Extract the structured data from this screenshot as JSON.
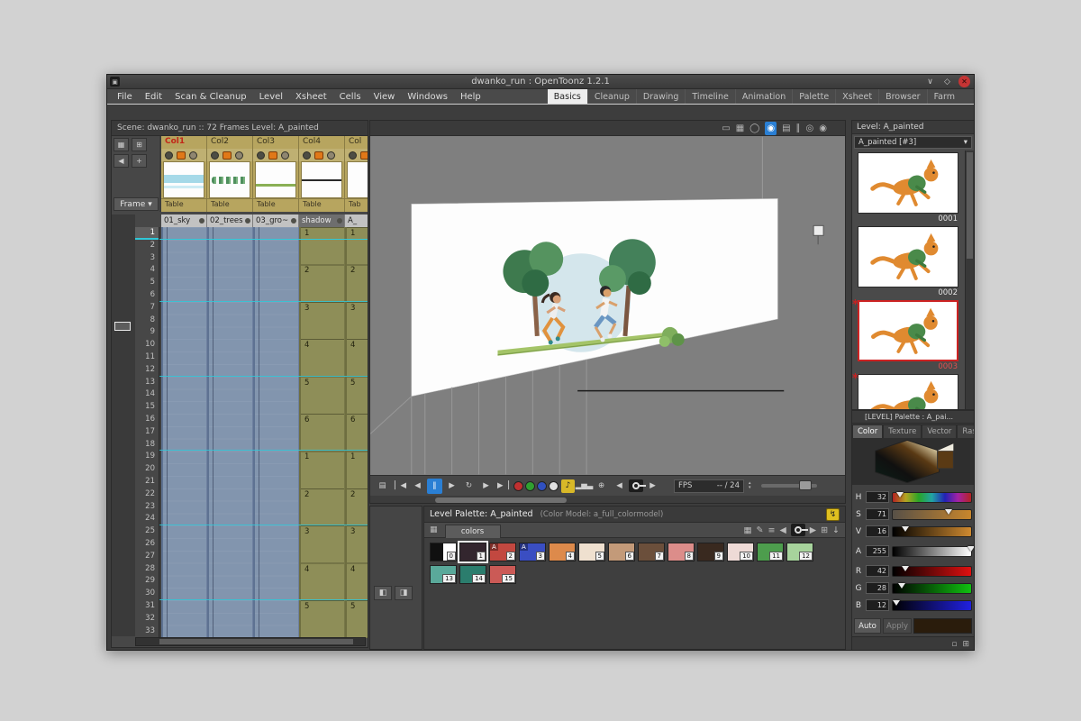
{
  "theme": {
    "bg-desktop": "#d2d2d2",
    "bg-window": "#484848",
    "accent-blue": "#2a7fd4",
    "cell-blue": "#8295ae",
    "cell-blue-line": "#5e7292",
    "cell-olive": "#8e8e58",
    "cell-olive-line": "#6e6e40",
    "header-tan": "#b7a55f",
    "current-cyan": "#30c8d8",
    "select-red": "#cc2222"
  },
  "window": {
    "title": "dwanko_run : OpenToonz 1.2.1",
    "app_icon_glyph": "▣",
    "controls": [
      {
        "name": "minimize-button",
        "glyph": "∨"
      },
      {
        "name": "restore-button",
        "glyph": "◇"
      },
      {
        "name": "close-button",
        "glyph": "✕",
        "close": true
      }
    ]
  },
  "menu": {
    "items": [
      "File",
      "Edit",
      "Scan & Cleanup",
      "Level",
      "Xsheet",
      "Cells",
      "View",
      "Windows",
      "Help"
    ]
  },
  "rooms": {
    "active_index": 0,
    "items": [
      "Basics",
      "Cleanup",
      "Drawing",
      "Timeline",
      "Animation",
      "Palette",
      "Xsheet",
      "Browser",
      "Farm"
    ]
  },
  "xsheet": {
    "scene_info": "Scene: dwanko_run    ::    72 Frames    Level: A_painted",
    "toolbar_top": [
      {
        "name": "xsheet-table-icon",
        "glyph": "▦"
      },
      {
        "name": "xsheet-add-level-icon",
        "glyph": "⊞"
      }
    ],
    "toolbar_second": [
      {
        "name": "collapse-columns-icon",
        "glyph": "◀"
      },
      {
        "name": "new-level-icon",
        "glyph": "+"
      }
    ],
    "frame_button": "Frame",
    "frame_button_arrow": "▾",
    "columns": [
      {
        "header": "Col1",
        "header_red": true,
        "name": "01_sky",
        "table": "Table",
        "thumb": "sky"
      },
      {
        "header": "Col2",
        "name": "02_trees",
        "table": "Table",
        "thumb": "trees"
      },
      {
        "header": "Col3",
        "name": "03_gro~",
        "table": "Table",
        "thumb": "ground"
      },
      {
        "header": "Col4",
        "name": "shadow",
        "table": "Table",
        "thumb": "shadow",
        "dark_name": true
      },
      {
        "header": "Col",
        "name": "A_",
        "table": "Tab",
        "thumb": "none"
      }
    ],
    "frames": [
      1,
      2,
      3,
      4,
      5,
      6,
      7,
      8,
      9,
      10,
      11,
      12,
      13,
      14,
      15,
      16,
      17,
      18,
      19,
      20,
      21,
      22,
      23,
      24,
      25,
      26,
      27,
      28,
      29,
      30,
      31,
      32,
      33
    ],
    "cell_columns": [
      {
        "x": 0,
        "kind": "held"
      },
      {
        "x": 1,
        "kind": "held"
      },
      {
        "x": 2,
        "kind": "held"
      },
      {
        "x": 3,
        "kind": "keyed",
        "labels": [
          {
            "row": 1,
            "text": "1"
          },
          {
            "row": 4,
            "text": "2"
          },
          {
            "row": 7,
            "text": "3"
          },
          {
            "row": 10,
            "text": "4"
          },
          {
            "row": 13,
            "text": "5"
          },
          {
            "row": 16,
            "text": "6"
          },
          {
            "row": 19,
            "text": "1"
          },
          {
            "row": 22,
            "text": "2"
          },
          {
            "row": 25,
            "text": "3"
          },
          {
            "row": 28,
            "text": "4"
          },
          {
            "row": 31,
            "text": "5"
          }
        ]
      },
      {
        "x": 4,
        "kind": "keyed",
        "labels": [
          {
            "row": 1,
            "text": "1"
          },
          {
            "row": 4,
            "text": "2"
          },
          {
            "row": 7,
            "text": "3"
          },
          {
            "row": 10,
            "text": "4"
          },
          {
            "row": 13,
            "text": "5"
          },
          {
            "row": 16,
            "text": "6"
          },
          {
            "row": 19,
            "text": "1"
          },
          {
            "row": 22,
            "text": "2"
          },
          {
            "row": 25,
            "text": "3"
          },
          {
            "row": 28,
            "text": "4"
          },
          {
            "row": 31,
            "text": "5"
          }
        ]
      }
    ],
    "section_rows": [
      6,
      12,
      18,
      24,
      30
    ]
  },
  "viewer": {
    "titlebar_icons": [
      {
        "name": "standard-view-icon",
        "glyph": "▭"
      },
      {
        "name": "field-guide-icon",
        "glyph": "▦"
      },
      {
        "name": "safe-area-icon",
        "glyph": "◯"
      },
      {
        "name": "camera-view-icon",
        "glyph": "◉",
        "active": true
      },
      {
        "name": "camera-stand-view-icon",
        "glyph": "▤"
      },
      {
        "name": "freeze-icon",
        "glyph": "∥"
      },
      {
        "name": "preview-eye-icon",
        "glyph": "◎"
      },
      {
        "name": "sub-camera-preview-icon",
        "glyph": "◉"
      }
    ],
    "fps_label": "FPS",
    "fps_value": "-- / 24"
  },
  "flipconsole": {
    "left_icons": [
      {
        "name": "console-options-icon",
        "glyph": "▤"
      }
    ],
    "playback": [
      {
        "name": "first-frame-button",
        "glyph": "▏◀"
      },
      {
        "name": "prev-frame-button",
        "glyph": "◀"
      },
      {
        "name": "pause-button",
        "glyph": "∥",
        "active": true
      },
      {
        "name": "play-button",
        "glyph": "▶"
      },
      {
        "name": "loop-button",
        "glyph": "↻"
      },
      {
        "name": "next-frame-button",
        "glyph": "▶"
      },
      {
        "name": "last-frame-button",
        "glyph": "▶▕"
      }
    ],
    "channels": [
      {
        "name": "red-channel-button",
        "color": "#c03030"
      },
      {
        "name": "green-channel-button",
        "color": "#30a030"
      },
      {
        "name": "blue-channel-button",
        "color": "#3050c0"
      },
      {
        "name": "matte-channel-button",
        "color": "#e0e0e0"
      }
    ],
    "extras": [
      {
        "name": "sound-button",
        "glyph": "♪",
        "note": true
      },
      {
        "name": "histogram-button",
        "glyph": "▂▅▃"
      },
      {
        "name": "zoom-button",
        "glyph": "⊕"
      }
    ],
    "compare": [
      {
        "name": "prev-key-button",
        "glyph": "◀"
      },
      {
        "name": "define-sub-camera-key-button",
        "css": "key"
      },
      {
        "name": "next-key-button",
        "glyph": "▶"
      }
    ]
  },
  "palette": {
    "title": "Level Palette: A_painted",
    "color_model": "(Color Model: a_full_colormodel)",
    "freeze_glyph": "↯",
    "page_icon_glyph": "▦",
    "tab": "colors",
    "side_buttons": [
      {
        "name": "palette-gizmo-button",
        "glyph": "◧"
      },
      {
        "name": "palette-switch-button",
        "glyph": "◨"
      }
    ],
    "toolbar_icons": [
      {
        "name": "style-view-mode-icon",
        "glyph": "▦"
      },
      {
        "name": "rename-style-icon",
        "glyph": "✎"
      },
      {
        "name": "palette-menu-icon",
        "glyph": "≡"
      },
      {
        "name": "prev-palette-key-icon",
        "glyph": "◀"
      },
      {
        "name": "palette-key-icon",
        "css": "key"
      },
      {
        "name": "next-palette-key-icon",
        "glyph": "▶"
      },
      {
        "name": "new-style-page-icon",
        "glyph": "⊞"
      },
      {
        "name": "save-palette-icon",
        "glyph": "↓"
      }
    ],
    "swatches": [
      {
        "n": "0",
        "split": true,
        "c1": "#101010",
        "c2": "#ffffff"
      },
      {
        "n": "1",
        "color": "#33262e",
        "selected": true
      },
      {
        "n": "2",
        "color": "#c24840",
        "badge": "A"
      },
      {
        "n": "3",
        "color": "#3a4ec2",
        "badge": "A"
      },
      {
        "n": "4",
        "color": "#dd8a4b"
      },
      {
        "n": "5",
        "color": "#efe0cf"
      },
      {
        "n": "6",
        "color": "#c39a79"
      },
      {
        "n": "7",
        "color": "#6b4f3b"
      },
      {
        "n": "8",
        "color": "#dc8d8a"
      },
      {
        "n": "9",
        "color": "#39291f"
      },
      {
        "n": "10",
        "color": "#eedad6"
      },
      {
        "n": "11",
        "color": "#4d9d4d"
      },
      {
        "n": "12",
        "color": "#a7d39c"
      },
      {
        "n": "13",
        "color": "#5aa99a"
      },
      {
        "n": "14",
        "color": "#2b7d6d"
      },
      {
        "n": "15",
        "color": "#cb5a56"
      }
    ]
  },
  "level_strip": {
    "title": "Level: A_painted",
    "selector": "A_painted  [#3]",
    "selector_arrow": "▾",
    "frames": [
      {
        "number": "0001",
        "selected": false,
        "palette_icon": false
      },
      {
        "number": "0002",
        "selected": false,
        "palette_icon": false
      },
      {
        "number": "0003",
        "selected": true,
        "palette_icon": true
      },
      {
        "number": "",
        "selected": false,
        "palette_icon": true
      }
    ]
  },
  "style_editor": {
    "header": "[LEVEL] Palette : A_pai...",
    "tabs": [
      "Color",
      "Texture",
      "Vector",
      "Rast"
    ],
    "active_tab_index": 0,
    "tab_arrow": "▶",
    "hsv": [
      {
        "label": "H",
        "value": "32",
        "max": 359,
        "kind": "hue"
      },
      {
        "label": "S",
        "value": "71",
        "max": 100,
        "kind": "sat"
      },
      {
        "label": "V",
        "value": "16",
        "max": 100,
        "kind": "val"
      }
    ],
    "alpha": [
      {
        "label": "A",
        "value": "255",
        "max": 255,
        "kind": "alpha"
      }
    ],
    "rgb": [
      {
        "label": "R",
        "value": "42",
        "max": 255,
        "kind": "red"
      },
      {
        "label": "G",
        "value": "28",
        "max": 255,
        "kind": "green"
      },
      {
        "label": "B",
        "value": "12",
        "max": 255,
        "kind": "blue"
      }
    ],
    "auto_label": "Auto",
    "apply_label": "Apply",
    "current_color": "#2a1c0c",
    "bottom_icons": [
      {
        "name": "style-list-view-icon",
        "glyph": "▫"
      },
      {
        "name": "style-grid-view-icon",
        "glyph": "⊞"
      }
    ]
  }
}
